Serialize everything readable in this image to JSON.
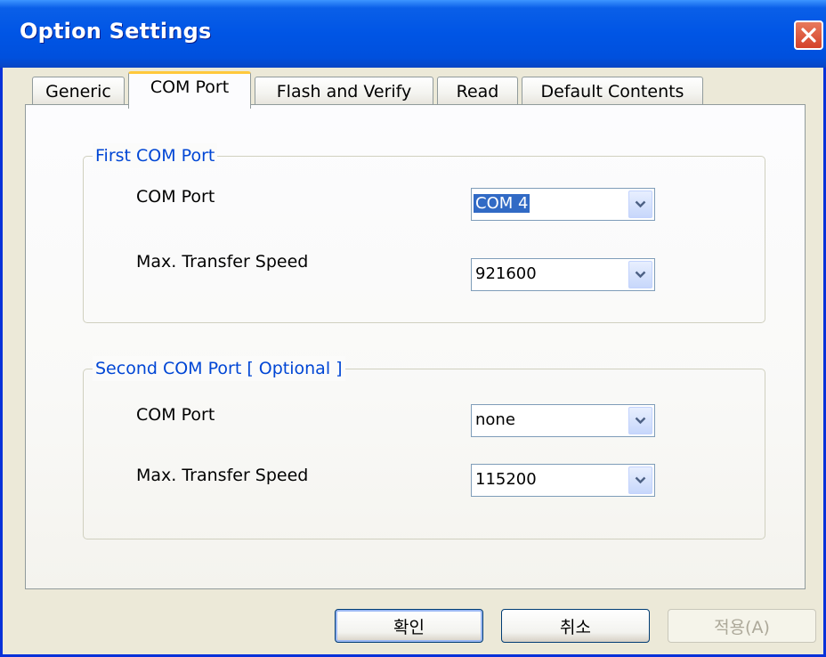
{
  "window": {
    "title": "Option Settings"
  },
  "tabs": [
    {
      "label": "Generic"
    },
    {
      "label": "COM Port"
    },
    {
      "label": "Flash and Verify"
    },
    {
      "label": "Read"
    },
    {
      "label": "Default Contents"
    }
  ],
  "active_tab": "COM Port",
  "first_com": {
    "legend": "First COM Port",
    "port_label": "COM Port",
    "port_value": "COM 4",
    "speed_label": "Max. Transfer Speed",
    "speed_value": "921600"
  },
  "second_com": {
    "legend": "Second COM Port [ Optional ]",
    "port_label": "COM Port",
    "port_value": "none",
    "speed_label": "Max. Transfer Speed",
    "speed_value": "115200"
  },
  "buttons": {
    "ok": "확인",
    "cancel": "취소",
    "apply": "적용(A)"
  },
  "colors": {
    "titlebar": "#0055e5",
    "legend_text": "#0046d5",
    "active_tab_accent": "#ffc83c",
    "close_button": "#d4412a",
    "selection": "#316ac5"
  },
  "icons": {
    "close": "close-icon",
    "dropdown": "chevron-down-icon"
  }
}
